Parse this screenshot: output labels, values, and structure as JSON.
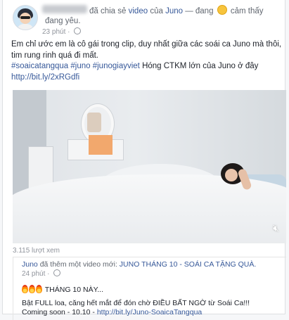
{
  "post": {
    "author_visible": "",
    "headline_action": "đã chia sẻ ",
    "headline_video": "video",
    "headline_of": " của ",
    "headline_page": "Juno",
    "headline_feeling": " — đang ",
    "headline_feeling_text": " cảm thấy",
    "headline_feeling_cont": "đang yêu.",
    "time": "23 phút",
    "text_line1": "Em chỉ ước em là cô gái trong clip, duy nhất giữa các soái ca Juno mà thôi,",
    "text_line2": "tim rung rinh quá đi mất.",
    "hashtags": "#soaicatangqua #juno #junogiayviet",
    "text_line3_rest": " Hóng CTKM lớn của Juno ở đây",
    "link": "http://bit.ly/2xRGdfi"
  },
  "video": {
    "views": "3.115 lượt xem",
    "mute_icon": "speaker-muted-icon"
  },
  "shared_post": {
    "page": "Juno",
    "action": " đã thêm một video mới: ",
    "video_title": "JUNO THÁNG 10 - SOÁI CA TẶNG QUÀ.",
    "time": "24 phút",
    "line1": "THÁNG 10 NÀY...",
    "line2": "Bật FULL loa, căng hết mắt để đón chờ ĐIỀU BẤT NGỜ từ Soái Ca!!!",
    "line3_prefix": "Coming soon - 10.10 - ",
    "line3_link": "http://bit.ly/Juno-SoaicaTangqua"
  },
  "colors": {
    "link": "#365899",
    "meta": "#90949c",
    "text": "#1d2129"
  }
}
